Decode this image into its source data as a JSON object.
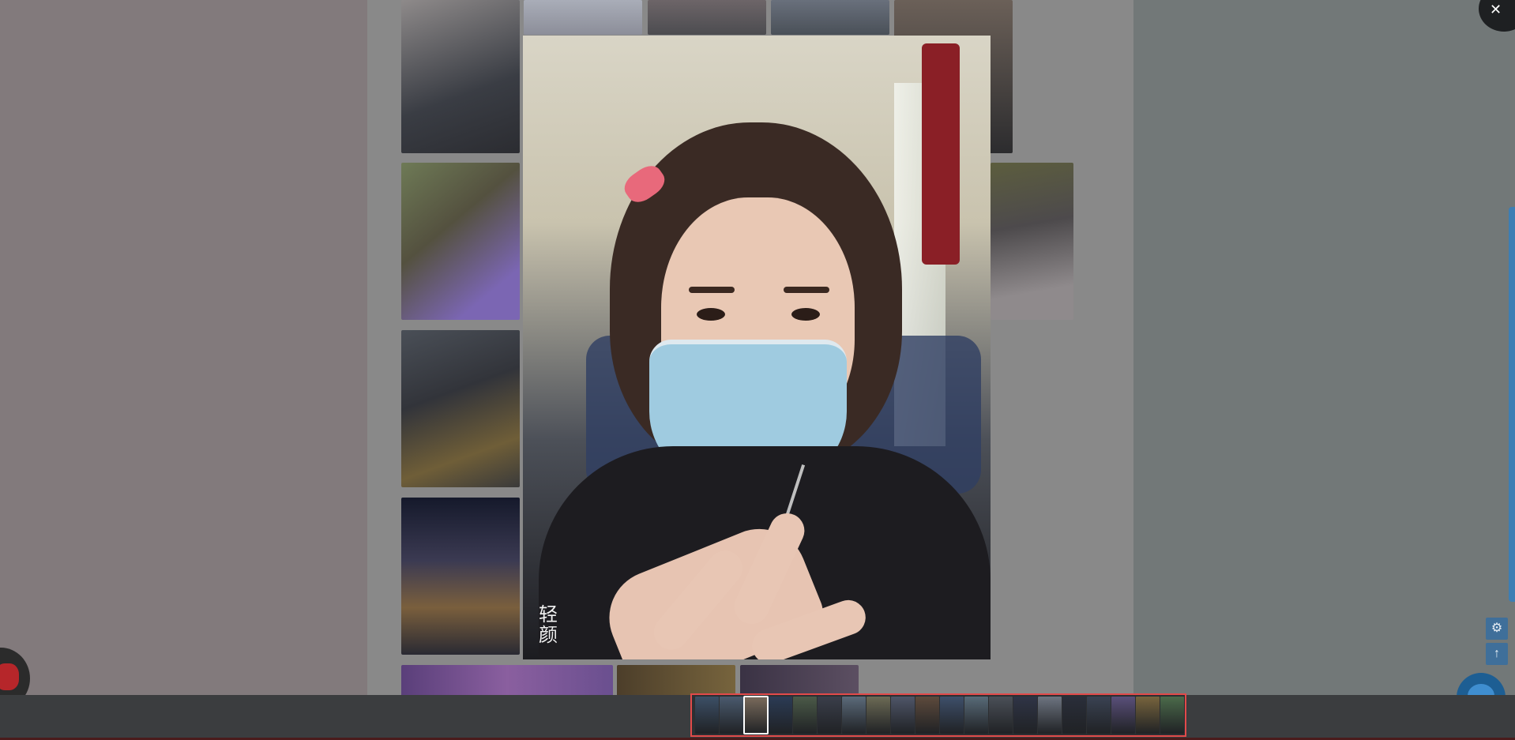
{
  "viewer": {
    "close_label": "✕",
    "watermark": "轻\n颜"
  },
  "icons": {
    "close": "close-icon",
    "settings": "gear-icon",
    "back_to_top": "arrow-up-icon",
    "chat": "chat-bubble-icon"
  },
  "side_tools": {
    "settings_glyph": "⚙",
    "top_glyph": "↑"
  },
  "filmstrip": {
    "active_index": 2,
    "count": 20
  },
  "colors": {
    "highlight_border": "#e24a4a",
    "tool_blue": "#3f6f9a",
    "chat_blue": "#1d5e93"
  }
}
